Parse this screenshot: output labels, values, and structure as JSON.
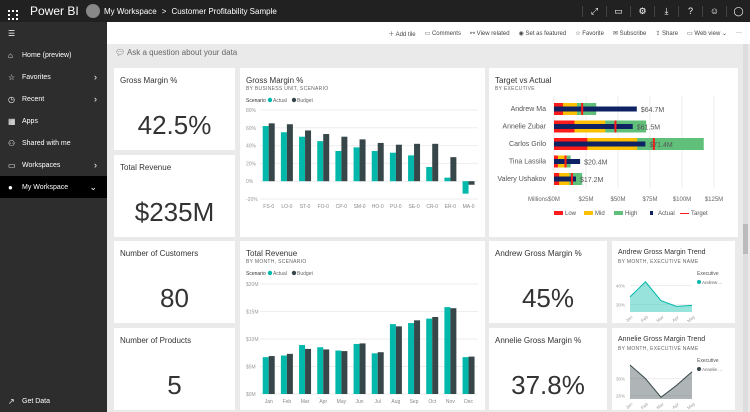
{
  "topbar": {
    "brand": "Power BI",
    "workspace": "My Workspace",
    "separator": ">",
    "report": "Customer Profitability Sample",
    "icons": [
      "expand-icon",
      "comment-icon",
      "settings-icon",
      "download-icon",
      "help-icon",
      "smiley-icon",
      "user-icon"
    ]
  },
  "sidebar": {
    "items": [
      {
        "label": "",
        "icon": "hamburger-icon"
      },
      {
        "label": "Home (preview)",
        "icon": "home-icon"
      },
      {
        "label": "Favorites",
        "icon": "star-icon",
        "chevron": true
      },
      {
        "label": "Recent",
        "icon": "clock-icon",
        "chevron": true
      },
      {
        "label": "Apps",
        "icon": "apps-icon"
      },
      {
        "label": "Shared with me",
        "icon": "share-icon"
      },
      {
        "label": "Workspaces",
        "icon": "workspaces-icon",
        "chevron": true
      },
      {
        "label": "My Workspace",
        "icon": "avatar",
        "chevron": true,
        "selected": true
      }
    ],
    "get_data": "Get Data"
  },
  "toolbar": {
    "add_tile": "Add tile",
    "comments": "Comments",
    "view_related": "View related",
    "set_featured": "Set as featured",
    "favorite": "Favorite",
    "subscribe": "Subscribe",
    "share": "Share",
    "web_view": "Web view",
    "more": "···"
  },
  "qa": {
    "placeholder": "Ask a question about your data"
  },
  "tiles": {
    "gm": {
      "title": "Gross Margin %",
      "value": "42.5%"
    },
    "rev": {
      "title": "Total Revenue",
      "value": "$235M"
    },
    "cust": {
      "title": "Number of Customers",
      "value": "80"
    },
    "prod": {
      "title": "Number of Products",
      "value": "5"
    },
    "agm": {
      "title": "Andrew Gross Margin %",
      "value": "45%"
    },
    "bgm": {
      "title": "Annelie Gross Margin %",
      "value": "37.8%"
    }
  },
  "colors": {
    "actual": "#01b8aa",
    "budget": "#374649",
    "low": "#fd1a1a",
    "mid": "#fdc000",
    "high": "#60c07a",
    "target_actual": "#0e2162"
  },
  "chart_data": [
    {
      "id": "gmchart",
      "type": "bar",
      "title": "Gross Margin %",
      "subtitle": "BY BUSINESS UNIT, SCENARIO",
      "legend_title": "Scenario",
      "categories": [
        "FS-0",
        "LO-0",
        "ST-0",
        "FO-0",
        "CP-0",
        "SM-0",
        "HO-0",
        "PU-0",
        "SE-0",
        "CR-0",
        "ER-0",
        "MA-0"
      ],
      "series": [
        {
          "name": "Actual",
          "values": [
            62,
            55,
            50,
            45,
            34,
            38,
            34,
            32,
            29,
            16,
            4,
            -14
          ]
        },
        {
          "name": "Budget",
          "values": [
            65,
            64,
            57,
            53,
            50,
            47,
            43,
            41,
            42,
            42,
            27,
            -4
          ]
        }
      ],
      "ylim": [
        -20,
        80
      ],
      "yticks": [
        "-20%",
        "0%",
        "20%",
        "40%",
        "60%",
        "80%"
      ],
      "grid": true
    },
    {
      "id": "tvachart",
      "type": "bar",
      "title": "Target vs Actual",
      "subtitle": "BY EXECUTIVE",
      "categories": [
        "Andrew Ma",
        "Annelie Zubar",
        "Carlos Grilo",
        "Tina Lassila",
        "Valery Ushakov"
      ],
      "low": [
        7,
        16,
        26,
        3,
        4
      ],
      "mid": [
        18,
        40,
        65,
        10,
        12
      ],
      "high": [
        33,
        72,
        117,
        13,
        22
      ],
      "actual": [
        64.7,
        61.5,
        71.4,
        20.4,
        17.2
      ],
      "target": [
        22,
        48,
        78,
        9,
        14
      ],
      "data_labels": [
        "$64.7M",
        "$61.5M",
        "$71.4M",
        "$20.4M",
        "$17.2M"
      ],
      "xlabel": "Millions",
      "xticks": [
        "$0M",
        "$25M",
        "$50M",
        "$75M",
        "$100M",
        "$125M"
      ],
      "xlim": [
        0,
        125
      ],
      "legend": [
        "Low",
        "Mid",
        "High",
        "Actual",
        "Target"
      ]
    },
    {
      "id": "revchart",
      "type": "bar",
      "title": "Total Revenue",
      "subtitle": "BY MONTH, SCENARIO",
      "legend_title": "Scenario",
      "categories": [
        "Jan",
        "Feb",
        "Mar",
        "Apr",
        "May",
        "Jun",
        "Jul",
        "Aug",
        "Sep",
        "Oct",
        "Nov",
        "Dec"
      ],
      "series": [
        {
          "name": "Actual",
          "values": [
            6.7,
            7.0,
            8.9,
            8.5,
            7.9,
            9.1,
            7.4,
            12.7,
            12.9,
            13.7,
            15.8,
            6.7
          ]
        },
        {
          "name": "Budget",
          "values": [
            6.9,
            7.3,
            8.2,
            8.1,
            7.8,
            9.2,
            7.6,
            12.3,
            13.4,
            14.0,
            15.6,
            6.8
          ]
        }
      ],
      "ylim": [
        0,
        20
      ],
      "yticks": [
        "$0M",
        "$5M",
        "$10M",
        "$15M",
        "$20M"
      ],
      "grid": true
    },
    {
      "id": "atrend",
      "type": "area",
      "title": "Andrew Gross Margin Trend",
      "subtitle": "BY MONTH, EXECUTIVE NAME",
      "legend_title": "Executive",
      "series": [
        {
          "name": "Andrew ...",
          "values": [
            34,
            42,
            32,
            29,
            29.5
          ]
        }
      ],
      "categories": [
        "Jan",
        "Feb",
        "Mar",
        "Apr",
        "May"
      ],
      "ylim": [
        26,
        44
      ],
      "yticks": [
        {
          "v": 30,
          "l": "30%"
        },
        {
          "v": 40,
          "l": "40%"
        }
      ],
      "color": "#01b8aa"
    },
    {
      "id": "btrend",
      "type": "area",
      "title": "Annelie Gross Margin Trend",
      "subtitle": "BY MONTH, EXECUTIVE NAME",
      "legend_title": "Executive",
      "series": [
        {
          "name": "Annelie ...",
          "values": [
            34,
            30,
            24.5,
            28,
            32
          ]
        }
      ],
      "categories": [
        "Jan",
        "Feb",
        "Mar",
        "Apr",
        "May"
      ],
      "ylim": [
        24,
        34
      ],
      "yticks": [
        {
          "v": 25,
          "l": "25%"
        },
        {
          "v": 30,
          "l": "30%"
        }
      ],
      "color": "#374649"
    }
  ]
}
